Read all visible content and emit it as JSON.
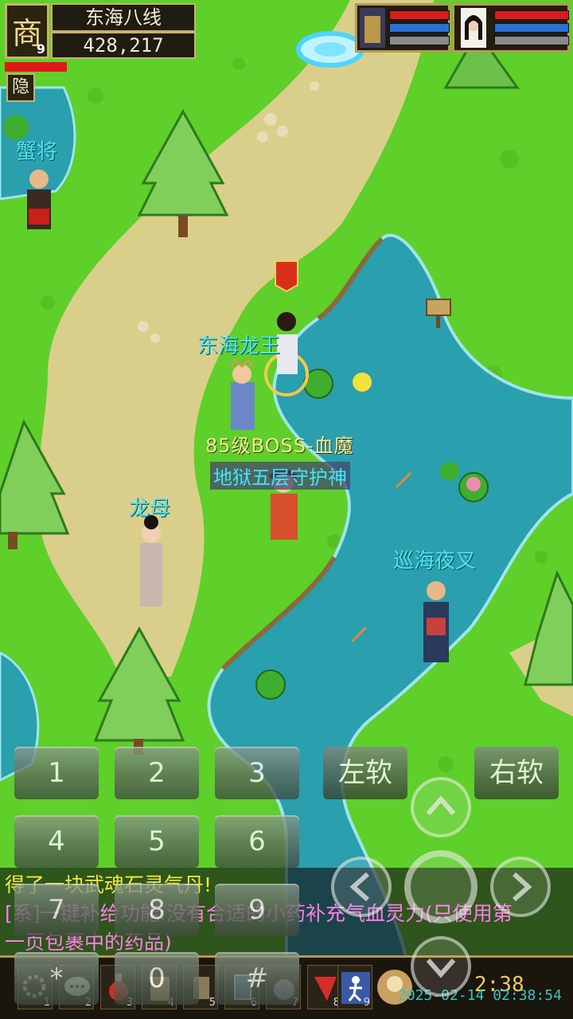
{
  "hud": {
    "avatar_glyph": "商",
    "level": "9",
    "server": "东海八线",
    "gold": "428,217",
    "hide_label": "隐"
  },
  "party": {
    "hp_color": "#d81c1c",
    "mp_color": "#2b6fd8",
    "exp_color": "#8a8a8a"
  },
  "map_labels": {
    "npc_crab_general": "蟹将",
    "npc_dragon_king": "东海龙王",
    "boss_title": "85级BOSS-血魔",
    "guard_title": "地狱五层守护神",
    "npc_dragon_mother": "龙母",
    "npc_patrol_yaksha": "巡海夜叉"
  },
  "chat": {
    "line1": "得了一块武魂石灵气丹!",
    "line2_tag": "[系]",
    "line2": "一键补给功能:没有合适的小药补充气血灵力(只使用第",
    "line3": "一页包裹中的药品)",
    "line1_color": "#f2ea3a",
    "system_color": "#ff7de8"
  },
  "keypad": {
    "keys": [
      "1",
      "2",
      "3",
      "4",
      "5",
      "6",
      "7",
      "8",
      "9",
      "*",
      "0",
      "#"
    ],
    "left_soft": "左软",
    "right_soft": "右软"
  },
  "bottom_bar": {
    "slots": [
      "1",
      "2",
      "3",
      "4",
      "5",
      "6",
      "7",
      "8",
      "9"
    ],
    "clock": "2:38",
    "timestamp": "2025-02-14 02:38:54"
  }
}
